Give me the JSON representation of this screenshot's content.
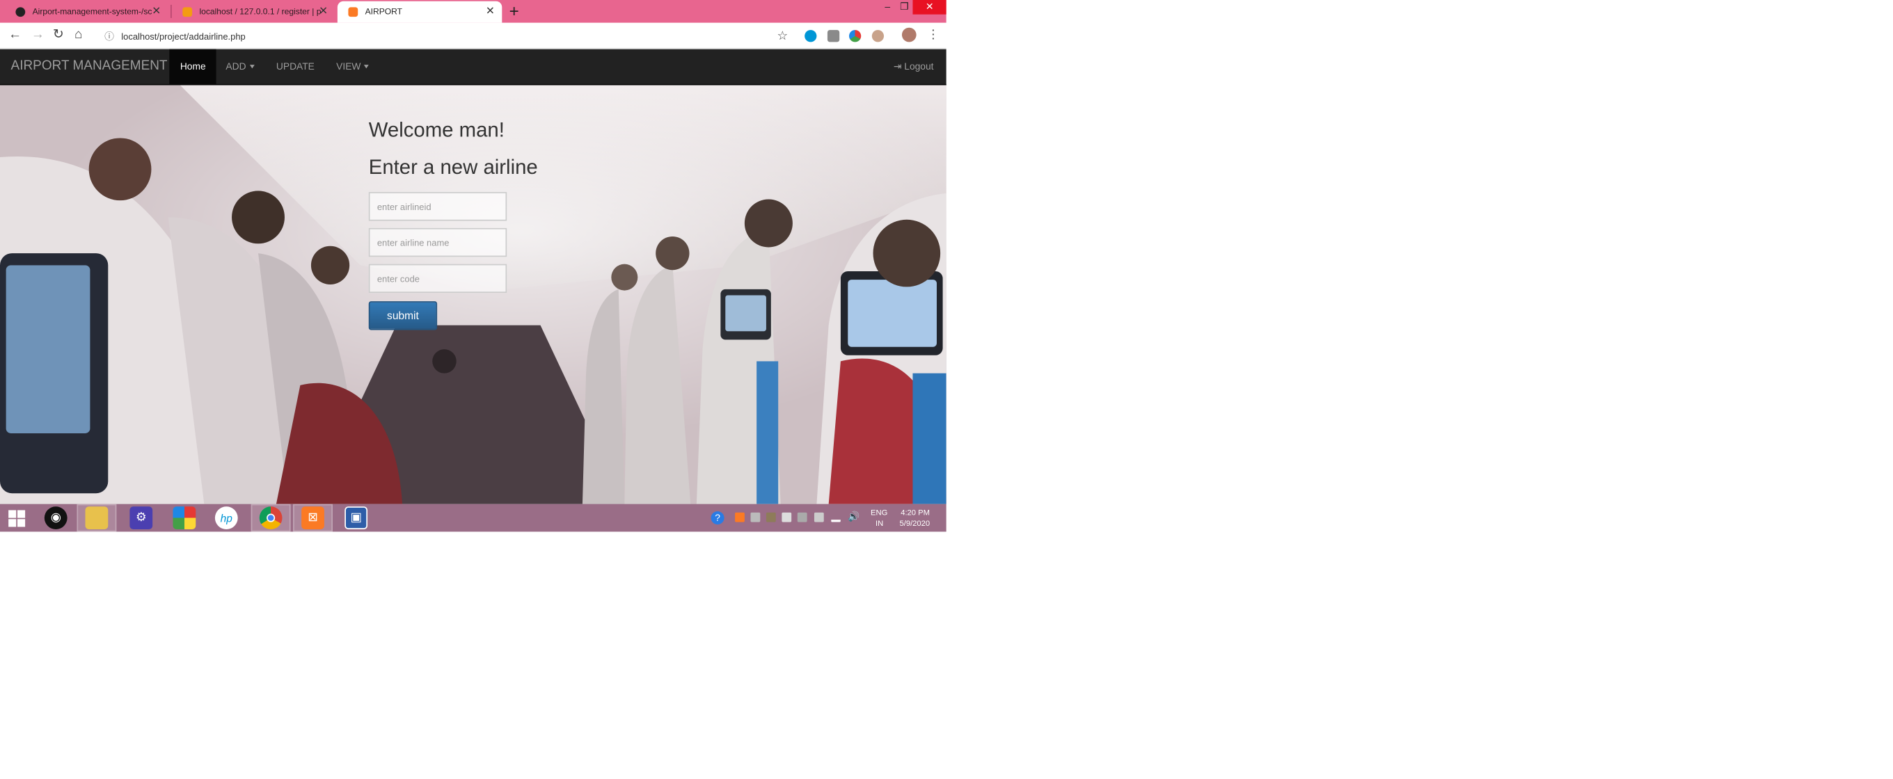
{
  "browser": {
    "tabs": [
      {
        "title": "Airport-management-system-/sc",
        "favicon": "github-icon",
        "active": false
      },
      {
        "title": "localhost / 127.0.0.1 / register | p",
        "favicon": "phpmyadmin-icon",
        "active": false
      },
      {
        "title": "AIRPORT",
        "favicon": "xampp-icon",
        "active": true
      }
    ],
    "new_tab": "+",
    "url": "localhost/project/addairline.php",
    "window_controls": {
      "minimize": "–",
      "restore": "❐",
      "close": "✕"
    }
  },
  "navbar": {
    "brand": "AIRPORT MANAGEMENT",
    "items": [
      {
        "label": "Home",
        "active": true,
        "dropdown": false
      },
      {
        "label": "ADD",
        "active": false,
        "dropdown": true
      },
      {
        "label": "UPDATE",
        "active": false,
        "dropdown": false
      },
      {
        "label": "VIEW",
        "active": false,
        "dropdown": true
      }
    ],
    "logout": "Logout"
  },
  "main": {
    "greeting": "Welcome man!",
    "heading": "Enter a new airline",
    "fields": [
      {
        "placeholder": "enter airlineid",
        "value": ""
      },
      {
        "placeholder": "enter airline name",
        "value": ""
      },
      {
        "placeholder": "enter code",
        "value": ""
      }
    ],
    "submit_label": "submit"
  },
  "taskbar": {
    "lang_line1": "ENG",
    "lang_line2": "IN",
    "time": "4:20 PM",
    "date": "5/9/2020"
  },
  "colors": {
    "tab_strip": "#e8658f",
    "navbar": "#222222",
    "submit_button": "#337ab7",
    "taskbar": "#9a6d87"
  }
}
